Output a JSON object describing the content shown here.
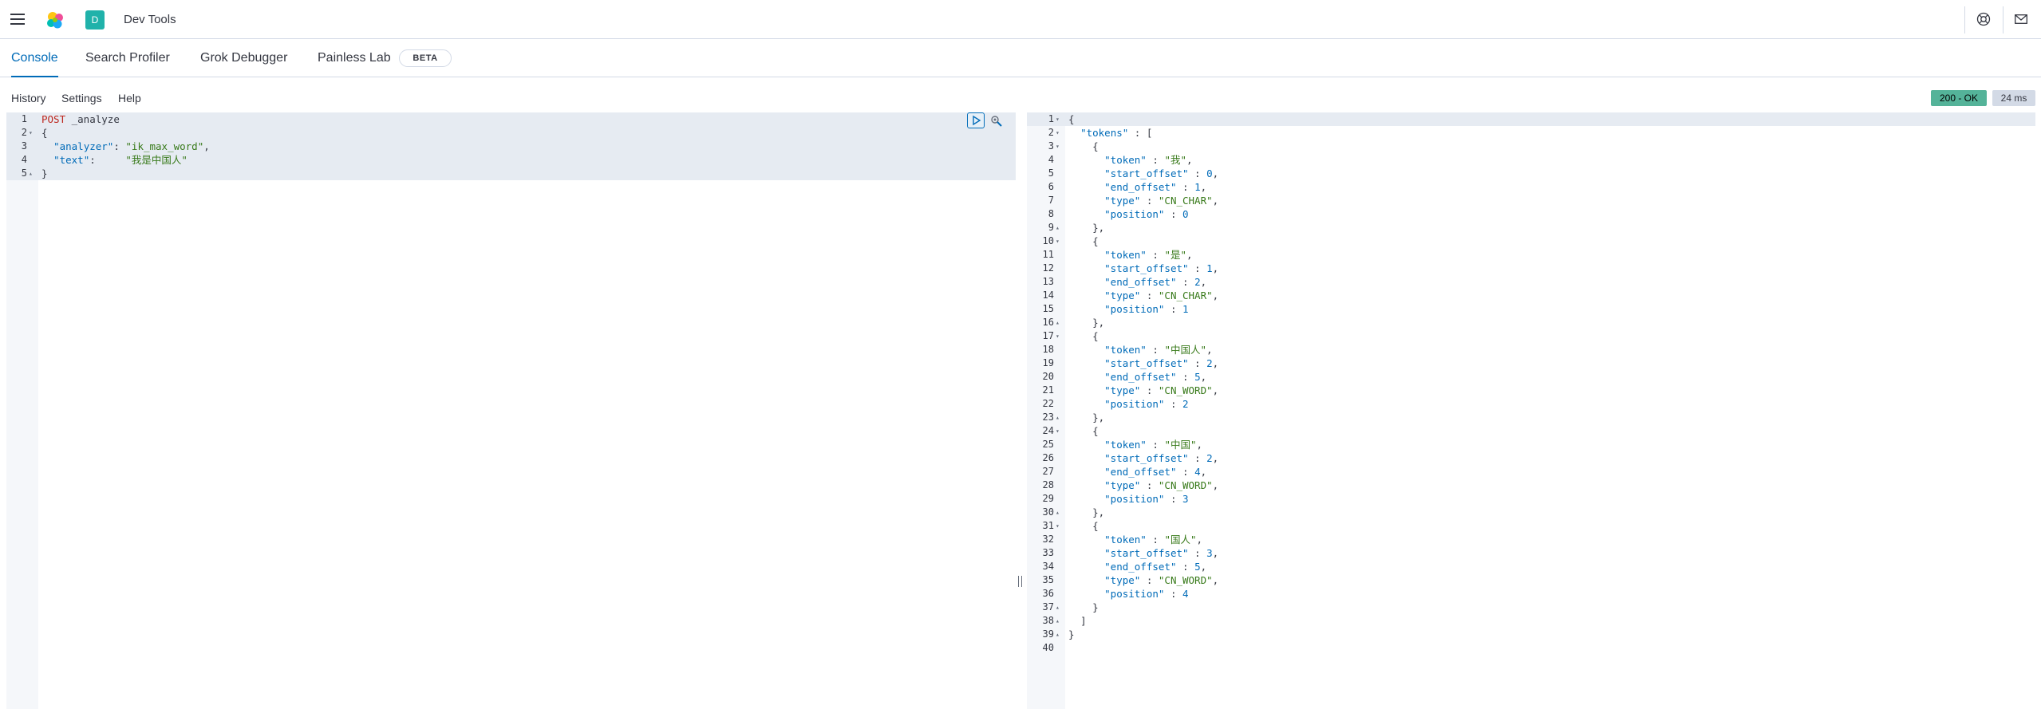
{
  "header": {
    "space_initial": "D",
    "app_title": "Dev Tools",
    "icons": [
      "menu-icon",
      "elastic-logo",
      "help-icon",
      "mail-icon"
    ]
  },
  "tabs": [
    {
      "label": "Console",
      "active": true
    },
    {
      "label": "Search Profiler",
      "active": false
    },
    {
      "label": "Grok Debugger",
      "active": false
    },
    {
      "label": "Painless Lab",
      "active": false
    }
  ],
  "beta_label": "BETA",
  "toolbar": {
    "history": "History",
    "settings": "Settings",
    "help": "Help",
    "status": "200 - OK",
    "time": "24 ms"
  },
  "request": {
    "lines": [
      {
        "n": "1",
        "text": "POST _analyze"
      },
      {
        "n": "2",
        "text": "{"
      },
      {
        "n": "3",
        "text": "  \"analyzer\": \"ik_max_word\","
      },
      {
        "n": "4",
        "text": "  \"text\":     \"我是中国人\""
      },
      {
        "n": "5",
        "text": "}"
      }
    ]
  },
  "response": {
    "lines": [
      {
        "n": "1",
        "text": "{"
      },
      {
        "n": "2",
        "text": "  \"tokens\" : ["
      },
      {
        "n": "3",
        "text": "    {"
      },
      {
        "n": "4",
        "text": "      \"token\" : \"我\","
      },
      {
        "n": "5",
        "text": "      \"start_offset\" : 0,"
      },
      {
        "n": "6",
        "text": "      \"end_offset\" : 1,"
      },
      {
        "n": "7",
        "text": "      \"type\" : \"CN_CHAR\","
      },
      {
        "n": "8",
        "text": "      \"position\" : 0"
      },
      {
        "n": "9",
        "text": "    },"
      },
      {
        "n": "10",
        "text": "    {"
      },
      {
        "n": "11",
        "text": "      \"token\" : \"是\","
      },
      {
        "n": "12",
        "text": "      \"start_offset\" : 1,"
      },
      {
        "n": "13",
        "text": "      \"end_offset\" : 2,"
      },
      {
        "n": "14",
        "text": "      \"type\" : \"CN_CHAR\","
      },
      {
        "n": "15",
        "text": "      \"position\" : 1"
      },
      {
        "n": "16",
        "text": "    },"
      },
      {
        "n": "17",
        "text": "    {"
      },
      {
        "n": "18",
        "text": "      \"token\" : \"中国人\","
      },
      {
        "n": "19",
        "text": "      \"start_offset\" : 2,"
      },
      {
        "n": "20",
        "text": "      \"end_offset\" : 5,"
      },
      {
        "n": "21",
        "text": "      \"type\" : \"CN_WORD\","
      },
      {
        "n": "22",
        "text": "      \"position\" : 2"
      },
      {
        "n": "23",
        "text": "    },"
      },
      {
        "n": "24",
        "text": "    {"
      },
      {
        "n": "25",
        "text": "      \"token\" : \"中国\","
      },
      {
        "n": "26",
        "text": "      \"start_offset\" : 2,"
      },
      {
        "n": "27",
        "text": "      \"end_offset\" : 4,"
      },
      {
        "n": "28",
        "text": "      \"type\" : \"CN_WORD\","
      },
      {
        "n": "29",
        "text": "      \"position\" : 3"
      },
      {
        "n": "30",
        "text": "    },"
      },
      {
        "n": "31",
        "text": "    {"
      },
      {
        "n": "32",
        "text": "      \"token\" : \"国人\","
      },
      {
        "n": "33",
        "text": "      \"start_offset\" : 3,"
      },
      {
        "n": "34",
        "text": "      \"end_offset\" : 5,"
      },
      {
        "n": "35",
        "text": "      \"type\" : \"CN_WORD\","
      },
      {
        "n": "36",
        "text": "      \"position\" : 4"
      },
      {
        "n": "37",
        "text": "    }"
      },
      {
        "n": "38",
        "text": "  ]"
      },
      {
        "n": "39",
        "text": "}"
      },
      {
        "n": "40",
        "text": ""
      }
    ]
  },
  "colors": {
    "accent": "#006bb8",
    "status_ok": "#54b399",
    "space_badge": "#20b2aa"
  }
}
